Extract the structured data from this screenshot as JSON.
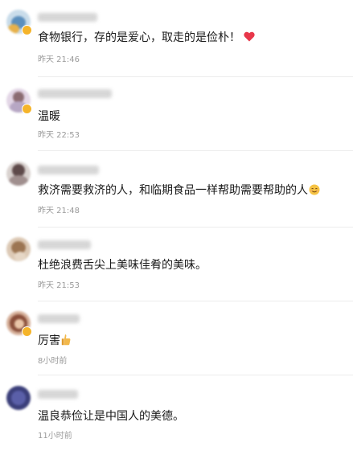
{
  "colors": {
    "text": "#1a1a1a",
    "time": "#9a9a9a",
    "divider": "#ececec",
    "verified_badge": "#f5b42a",
    "heart": "#e8374a"
  },
  "comments": [
    {
      "text": "食物银行，存的是爱心，取走的是俭朴！",
      "time": "昨天 21:46",
      "emoji": "heart-emoji-icon",
      "verified": true
    },
    {
      "text": "温暖",
      "time": "昨天 22:53",
      "emoji": "",
      "verified": true
    },
    {
      "text": "救济需要救济的人，和临期食品一样帮助需要帮助的人",
      "time": "昨天 21:48",
      "emoji": "smiling-face-emoji-icon",
      "verified": false
    },
    {
      "text": "杜绝浪费舌尖上美味佳肴的美味。",
      "time": "昨天 21:53",
      "emoji": "",
      "verified": false
    },
    {
      "text": "厉害",
      "time": "8小时前",
      "emoji": "thumbs-up-emoji-icon",
      "verified": true
    },
    {
      "text": "温良恭俭让是中国人的美德。",
      "time": "11小时前",
      "emoji": "",
      "verified": false
    }
  ]
}
